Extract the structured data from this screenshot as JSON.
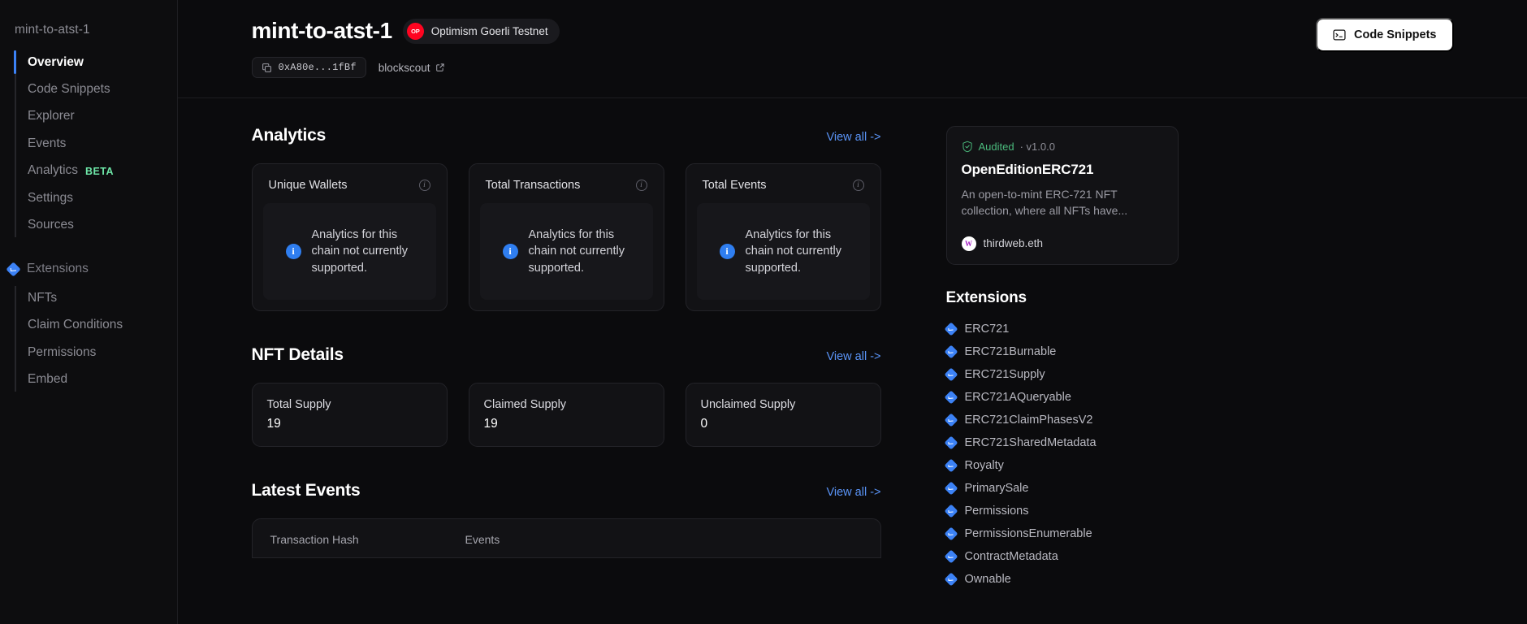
{
  "sidebar": {
    "project_title": "mint-to-atst-1",
    "items": [
      {
        "label": "Overview",
        "active": true
      },
      {
        "label": "Code Snippets",
        "active": false
      },
      {
        "label": "Explorer",
        "active": false
      },
      {
        "label": "Events",
        "active": false
      },
      {
        "label": "Analytics",
        "active": false,
        "badge": "BETA"
      },
      {
        "label": "Settings",
        "active": false
      },
      {
        "label": "Sources",
        "active": false
      }
    ],
    "extensions_section": {
      "label": "Extensions",
      "icon": "diamond-check-icon",
      "items": [
        {
          "label": "NFTs"
        },
        {
          "label": "Claim Conditions"
        },
        {
          "label": "Permissions"
        },
        {
          "label": "Embed"
        }
      ]
    }
  },
  "header": {
    "title": "mint-to-atst-1",
    "network": {
      "name": "Optimism Goerli Testnet",
      "logo_text": "OP",
      "logo_color": "#ff0420"
    },
    "address": "0xA80e...1fBf",
    "copy_icon": "copy-icon",
    "explorer": {
      "label": "blockscout",
      "icon": "external-link-icon"
    },
    "code_snippets_button": {
      "label": "Code Snippets",
      "icon": "terminal-icon"
    }
  },
  "analytics": {
    "title": "Analytics",
    "view_all": "View all ->",
    "cards": [
      {
        "label": "Unique Wallets",
        "message": "Analytics for this chain not currently supported."
      },
      {
        "label": "Total Transactions",
        "message": "Analytics for this chain not currently supported."
      },
      {
        "label": "Total Events",
        "message": "Analytics for this chain not currently supported."
      }
    ]
  },
  "nft_details": {
    "title": "NFT Details",
    "view_all": "View all ->",
    "cards": [
      {
        "label": "Total Supply",
        "value": "19"
      },
      {
        "label": "Claimed Supply",
        "value": "19"
      },
      {
        "label": "Unclaimed Supply",
        "value": "0"
      }
    ]
  },
  "latest_events": {
    "title": "Latest Events",
    "view_all": "View all ->",
    "columns": [
      "Transaction Hash",
      "Events"
    ]
  },
  "contract_card": {
    "audited_label": "Audited",
    "version": "· v1.0.0",
    "name": "OpenEditionERC721",
    "description": "An open-to-mint ERC-721 NFT collection, where all NFTs have...",
    "publisher": "thirdweb.eth",
    "publisher_initial": "W"
  },
  "extensions_panel": {
    "title": "Extensions",
    "items": [
      "ERC721",
      "ERC721Burnable",
      "ERC721Supply",
      "ERC721AQueryable",
      "ERC721ClaimPhasesV2",
      "ERC721SharedMetadata",
      "Royalty",
      "PrimarySale",
      "Permissions",
      "PermissionsEnumerable",
      "ContractMetadata",
      "Ownable"
    ]
  },
  "colors": {
    "accent_blue": "#3c82f6",
    "link_blue": "#5a94f7",
    "beta_green": "#6ee7a8",
    "audited_green": "#4bbb7d",
    "optimism_red": "#ff0420",
    "page_bg": "#0b0b0d",
    "card_bg": "#121215"
  }
}
